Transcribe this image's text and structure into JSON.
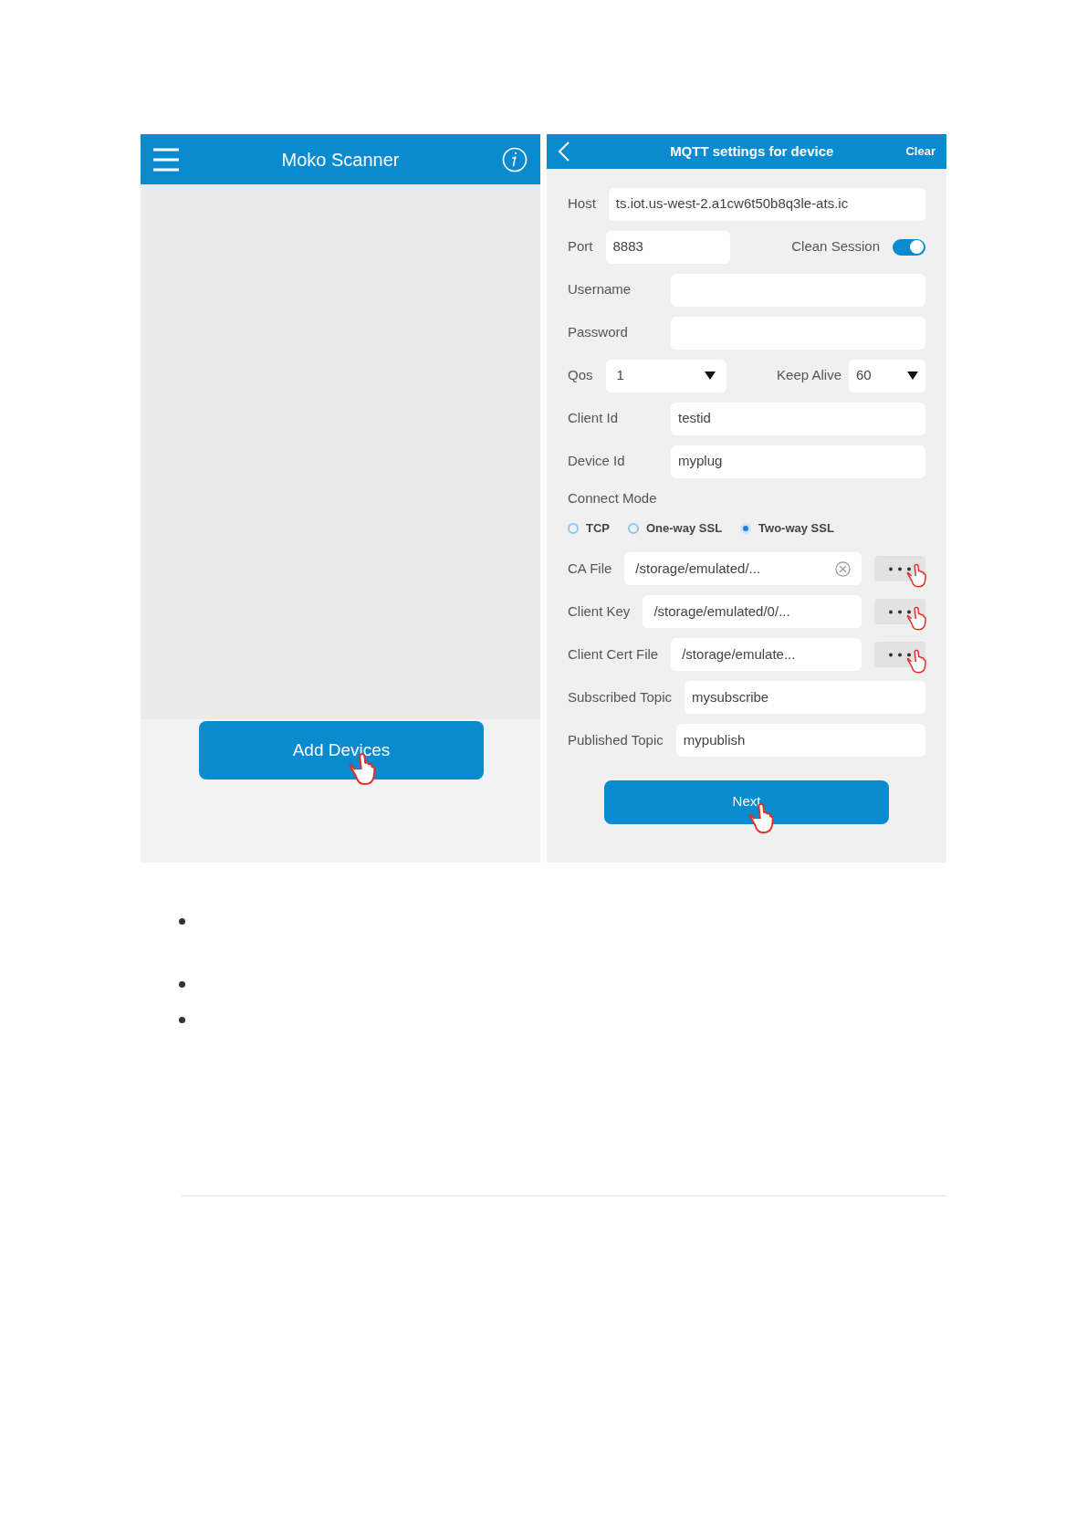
{
  "left_screen": {
    "title": "Moko Scanner",
    "add_button": "Add Devices"
  },
  "right_screen": {
    "title": "MQTT settings for device",
    "action": "Clear",
    "fields": [
      {
        "kind": "text",
        "label": "Host",
        "value": "ts.iot.us-west-2.a1cw6t50b8q3le-ats.ic"
      },
      {
        "kind": "port",
        "label": "Port",
        "value": "8883",
        "switch_label": "Clean Session",
        "on": true
      },
      {
        "kind": "text",
        "label": "Username"
      },
      {
        "kind": "text",
        "label": "Password"
      },
      {
        "kind": "selects",
        "label": "Qos",
        "value": "1",
        "label2": "Keep Alive",
        "value2": "60"
      },
      {
        "kind": "text",
        "label": "Client Id",
        "value": "testid"
      },
      {
        "kind": "text",
        "label": "Device Id",
        "value": "myplug"
      },
      {
        "kind": "radios",
        "label": "Connect Mode",
        "options": [
          {
            "label": "TCP",
            "selected": false
          },
          {
            "label": "One-way SSL",
            "selected": false
          },
          {
            "label": "Two-way SSL",
            "selected": true
          }
        ]
      },
      {
        "kind": "file",
        "label": "CA File",
        "value": "/storage/emulated/...",
        "clearable": true
      },
      {
        "kind": "file",
        "label": "Client Key",
        "value": "/storage/emulated/0/...",
        "clearable": false
      },
      {
        "kind": "file",
        "label": "Client Cert File",
        "value": "/storage/emulate...",
        "clearable": false
      },
      {
        "kind": "text",
        "label": "Subscribed Topic",
        "value": "mysubscribe"
      },
      {
        "kind": "text",
        "label": "Published Topic",
        "value": "mypublish"
      }
    ],
    "next_button": "Next"
  }
}
